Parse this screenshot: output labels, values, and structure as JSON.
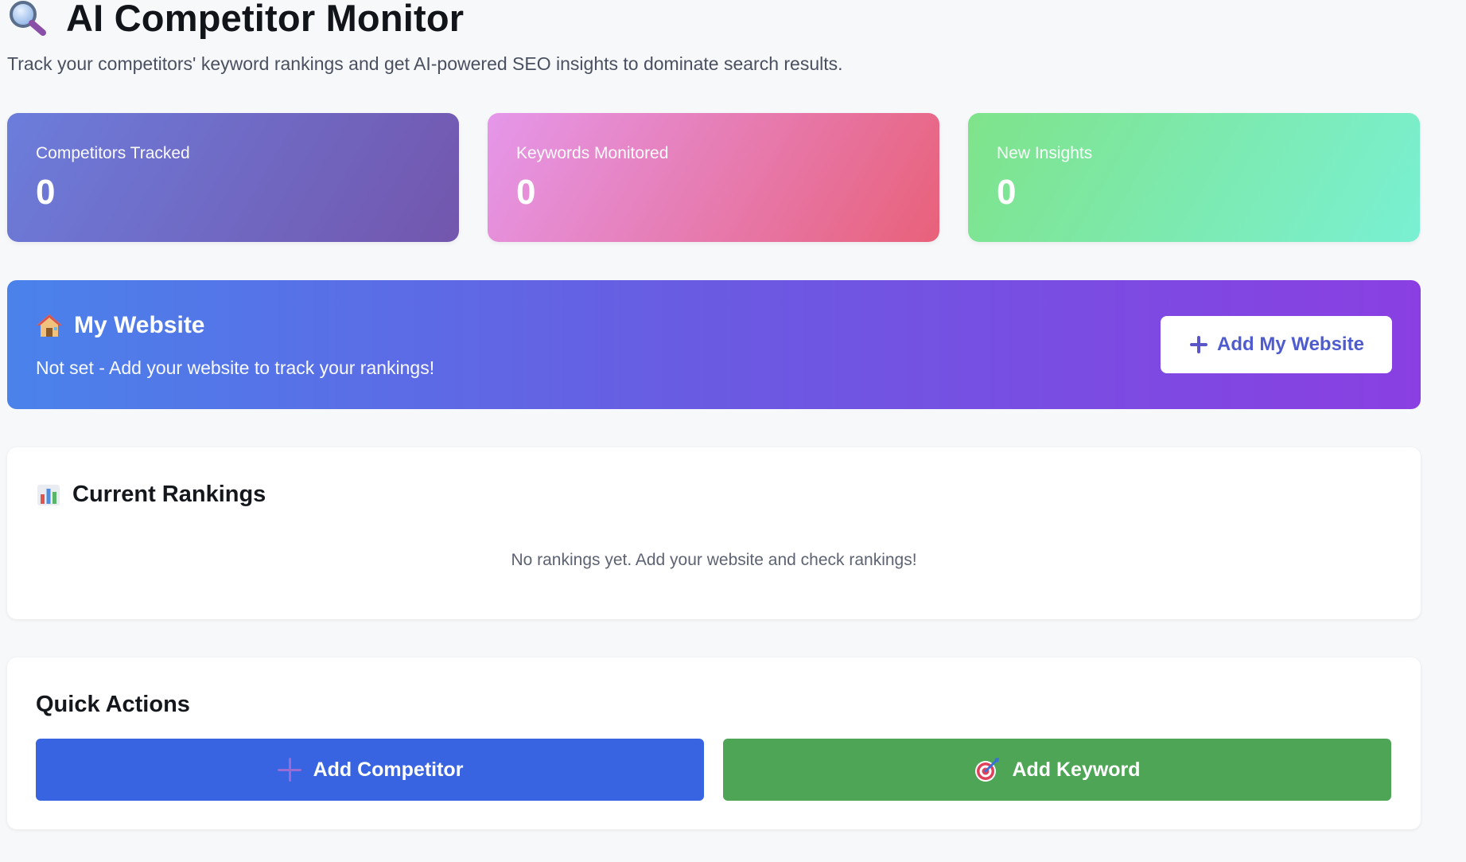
{
  "header": {
    "icon": "magnifying-glass-icon",
    "title": "AI Competitor Monitor",
    "subtitle": "Track your competitors' keyword rankings and get AI-powered SEO insights to dominate search results."
  },
  "stats": [
    {
      "label": "Competitors Tracked",
      "value": "0",
      "colors": [
        "#6c7ddb",
        "#7356ad"
      ]
    },
    {
      "label": "Keywords Monitored",
      "value": "0",
      "colors": [
        "#e597ea",
        "#e8617a"
      ]
    },
    {
      "label": "New Insights",
      "value": "0",
      "colors": [
        "#7fe38a",
        "#7af0d3"
      ]
    }
  ],
  "my_website": {
    "icon": "house-icon",
    "title": "My Website",
    "status": "Not set - Add your website to track your rankings!",
    "button_label": "Add My Website",
    "button_icon": "plus-icon"
  },
  "rankings": {
    "icon": "bar-chart-icon",
    "title": "Current Rankings",
    "empty_message": "No rankings yet. Add your website and check rankings!"
  },
  "quick_actions": {
    "title": "Quick Actions",
    "buttons": [
      {
        "label": "Add Competitor",
        "icon": "plus-icon",
        "color": "#3864e2"
      },
      {
        "label": "Add Keyword",
        "icon": "target-icon",
        "color": "#4ea556"
      }
    ]
  }
}
